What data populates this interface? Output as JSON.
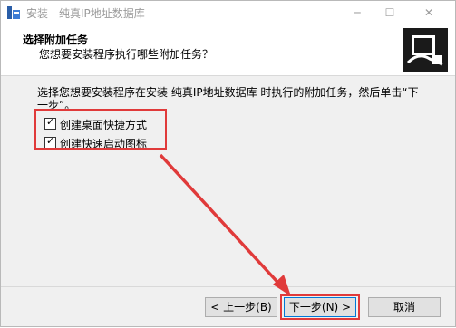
{
  "window": {
    "title": "安装 - 纯真IP地址数据库",
    "minimize_glyph": "─",
    "maximize_glyph": "☐",
    "close_glyph": "✕"
  },
  "header": {
    "title": "选择附加任务",
    "subtitle": "您想要安装程序执行哪些附加任务？"
  },
  "content": {
    "description": "选择您想要安装程序在安装 纯真IP地址数据库 时执行的附加任务，然后单击“下一步”。",
    "tasks": [
      {
        "label": "创建桌面快捷方式",
        "checked": true
      },
      {
        "label": "创建快速启动图标",
        "checked": true
      }
    ]
  },
  "buttons": {
    "back": "< 上一步(B)",
    "next": "下一步(N) >",
    "cancel": "取消"
  },
  "colors": {
    "highlight": "#e03a3a",
    "accent": "#0078d7"
  }
}
